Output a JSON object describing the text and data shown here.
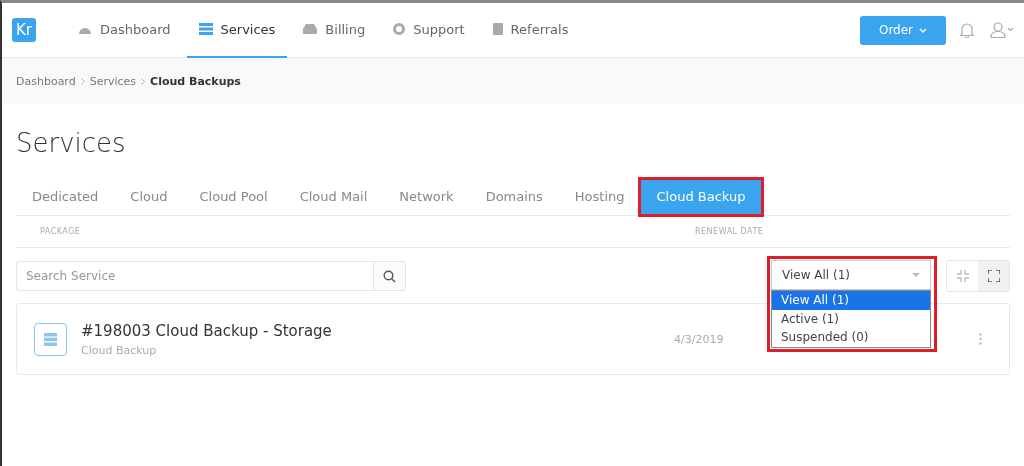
{
  "logo": "Kr",
  "nav": [
    {
      "label": "Dashboard",
      "selected": false
    },
    {
      "label": "Services",
      "selected": true
    },
    {
      "label": "Billing",
      "selected": false
    },
    {
      "label": "Support",
      "selected": false
    },
    {
      "label": "Referrals",
      "selected": false
    }
  ],
  "order_button": "Order",
  "breadcrumb": [
    {
      "label": "Dashboard",
      "current": false
    },
    {
      "label": "Services",
      "current": false
    },
    {
      "label": "Cloud Backups",
      "current": true
    }
  ],
  "title": "Services",
  "tabs": [
    {
      "label": "Dedicated",
      "selected": false,
      "highlighted": false
    },
    {
      "label": "Cloud",
      "selected": false,
      "highlighted": false
    },
    {
      "label": "Cloud Pool",
      "selected": false,
      "highlighted": false
    },
    {
      "label": "Cloud Mail",
      "selected": false,
      "highlighted": false
    },
    {
      "label": "Network",
      "selected": false,
      "highlighted": false
    },
    {
      "label": "Domains",
      "selected": false,
      "highlighted": false
    },
    {
      "label": "Hosting",
      "selected": false,
      "highlighted": false
    },
    {
      "label": "Cloud Backup",
      "selected": true,
      "highlighted": true
    }
  ],
  "columns": [
    "PACKAGE",
    "RENEWAL DATE"
  ],
  "search": {
    "placeholder": "Search Service"
  },
  "filter": {
    "value": "View All (1)",
    "expanded": true,
    "highlighted": true,
    "options": [
      {
        "label": "View All (1)",
        "selected": true
      },
      {
        "label": "Active (1)",
        "selected": false
      },
      {
        "label": "Suspended (0)",
        "selected": false
      }
    ]
  },
  "view_toggle": [
    {
      "selected": false
    },
    {
      "selected": true
    }
  ],
  "services": [
    {
      "name": "#198003 Cloud Backup - Storage",
      "type": "Cloud Backup",
      "renewal": "4/3/2019"
    }
  ]
}
